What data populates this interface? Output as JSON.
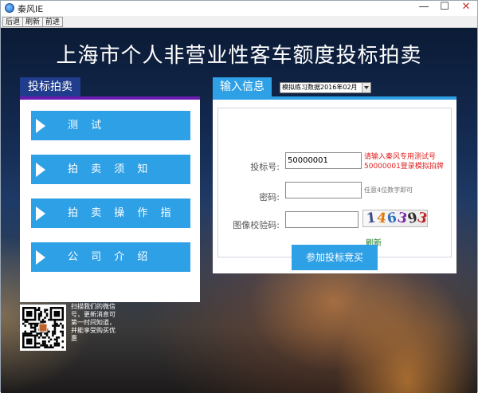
{
  "window": {
    "title": "秦风IE",
    "minimize": "—",
    "maximize": "☐",
    "close": "✕"
  },
  "toolbar": {
    "back": "后退",
    "refresh": "刷新",
    "forward": "前进"
  },
  "page": {
    "title": "上海市个人非营业性客车额度投标拍卖"
  },
  "left_panel": {
    "header": "投标拍卖",
    "menu": [
      {
        "label": "测 试"
      },
      {
        "label": "拍 卖 须 知"
      },
      {
        "label": "拍 卖 操 作 指 南"
      },
      {
        "label": "公 司 介 绍"
      }
    ]
  },
  "right_panel": {
    "header": "输入信息",
    "mode_select": "模拟练习数据2016年02月",
    "bid_number_label": "投标号:",
    "bid_number_value": "50000001",
    "bid_hint_line1": "请输入秦风专用测试号",
    "bid_hint_line2": "50000001登录模拟拍牌",
    "password_label": "密码:",
    "password_value": "",
    "password_hint": "任意4位数字即可",
    "captcha_label": "图像校验码:",
    "captcha_value": "",
    "captcha_chars": [
      {
        "ch": "1",
        "color": "#3b4a8a"
      },
      {
        "ch": "4",
        "color": "#e07a10"
      },
      {
        "ch": "6",
        "color": "#2d6fbf"
      },
      {
        "ch": "3",
        "color": "#7a2aa8"
      },
      {
        "ch": "9",
        "color": "#2c2c2c"
      },
      {
        "ch": "3",
        "color": "#c02020"
      }
    ],
    "refresh_link": "刷新",
    "submit": "参加投标竞买"
  },
  "qr": {
    "caption": "扫描我们的微信号，更新消息可第一时间知道，并能享受购买优惠"
  },
  "colors": {
    "accent_blue": "#2ea0e6",
    "left_header": "#1f3d8c",
    "left_header_line": "#6a1bb0",
    "hint_red": "#e02020",
    "refresh_green": "#1a7a22"
  }
}
